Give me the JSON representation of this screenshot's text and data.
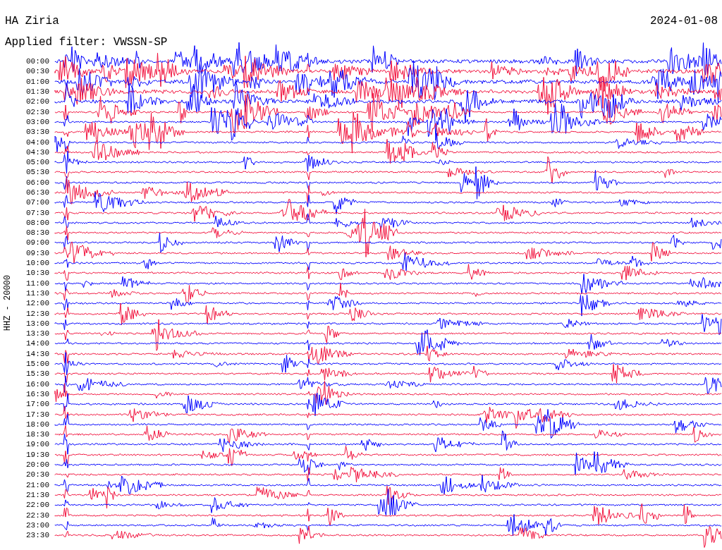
{
  "header": {
    "station": "HA Ziria",
    "date": "2024-01-08",
    "filter": "Applied filter: VWSSN-SP"
  },
  "axis_label": "HHZ - 20000",
  "traces": [
    {
      "label": "00:00",
      "color": "#0000ff"
    },
    {
      "label": "00:30",
      "color": "#f2103c"
    },
    {
      "label": "01:00",
      "color": "#0000ff"
    },
    {
      "label": "01:30",
      "color": "#f2103c"
    },
    {
      "label": "02:00",
      "color": "#0000ff"
    },
    {
      "label": "02:30",
      "color": "#f2103c"
    },
    {
      "label": "03:00",
      "color": "#0000ff"
    },
    {
      "label": "03:30",
      "color": "#f2103c"
    },
    {
      "label": "04:00",
      "color": "#0000ff"
    },
    {
      "label": "04:30",
      "color": "#f2103c"
    },
    {
      "label": "05:00",
      "color": "#0000ff"
    },
    {
      "label": "05:30",
      "color": "#f2103c"
    },
    {
      "label": "06:00",
      "color": "#0000ff"
    },
    {
      "label": "06:30",
      "color": "#f2103c"
    },
    {
      "label": "07:00",
      "color": "#0000ff"
    },
    {
      "label": "07:30",
      "color": "#f2103c"
    },
    {
      "label": "08:00",
      "color": "#0000ff"
    },
    {
      "label": "08:30",
      "color": "#f2103c"
    },
    {
      "label": "09:00",
      "color": "#0000ff"
    },
    {
      "label": "09:30",
      "color": "#f2103c"
    },
    {
      "label": "10:00",
      "color": "#0000ff"
    },
    {
      "label": "10:30",
      "color": "#f2103c"
    },
    {
      "label": "11:00",
      "color": "#0000ff"
    },
    {
      "label": "11:30",
      "color": "#f2103c"
    },
    {
      "label": "12:00",
      "color": "#0000ff"
    },
    {
      "label": "12:30",
      "color": "#f2103c"
    },
    {
      "label": "13:00",
      "color": "#0000ff"
    },
    {
      "label": "13:30",
      "color": "#f2103c"
    },
    {
      "label": "14:00",
      "color": "#0000ff"
    },
    {
      "label": "14:30",
      "color": "#f2103c"
    },
    {
      "label": "15:00",
      "color": "#0000ff"
    },
    {
      "label": "15:30",
      "color": "#f2103c"
    },
    {
      "label": "16:00",
      "color": "#0000ff"
    },
    {
      "label": "16:30",
      "color": "#f2103c"
    },
    {
      "label": "17:00",
      "color": "#0000ff"
    },
    {
      "label": "17:30",
      "color": "#f2103c"
    },
    {
      "label": "18:00",
      "color": "#0000ff"
    },
    {
      "label": "18:30",
      "color": "#f2103c"
    },
    {
      "label": "19:00",
      "color": "#0000ff"
    },
    {
      "label": "19:30",
      "color": "#f2103c"
    },
    {
      "label": "20:00",
      "color": "#0000ff"
    },
    {
      "label": "20:30",
      "color": "#f2103c"
    },
    {
      "label": "21:00",
      "color": "#0000ff"
    },
    {
      "label": "21:30",
      "color": "#f2103c"
    },
    {
      "label": "22:00",
      "color": "#0000ff"
    },
    {
      "label": "22:30",
      "color": "#f2103c"
    },
    {
      "label": "23:00",
      "color": "#0000ff"
    },
    {
      "label": "23:30",
      "color": "#f2103c"
    }
  ]
}
